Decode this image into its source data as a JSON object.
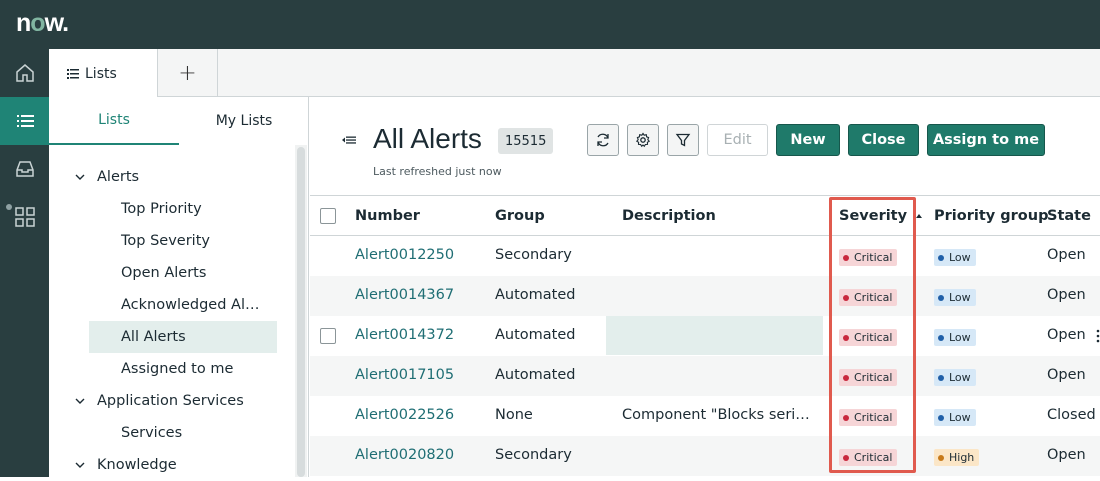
{
  "app": {
    "logo_text": "now",
    "brand_color": "#293e40",
    "accent_color": "#1f8476"
  },
  "rail": {
    "items": [
      "home-icon",
      "list-icon",
      "inbox-icon",
      "grid-icon"
    ],
    "active": "list-icon"
  },
  "tabs": {
    "lists_label": "Lists",
    "add_label": "+"
  },
  "sidebar": {
    "tabs": [
      "Lists",
      "My Lists"
    ],
    "active_tab": "Lists",
    "tree": [
      {
        "label": "Alerts",
        "type": "group"
      },
      {
        "label": "Top Priority",
        "type": "child"
      },
      {
        "label": "Top Severity",
        "type": "child"
      },
      {
        "label": "Open Alerts",
        "type": "child"
      },
      {
        "label": "Acknowledged Al…",
        "type": "child"
      },
      {
        "label": "All Alerts",
        "type": "child",
        "selected": true
      },
      {
        "label": "Assigned to me",
        "type": "child"
      },
      {
        "label": "Application Services",
        "type": "group"
      },
      {
        "label": "Services",
        "type": "child"
      },
      {
        "label": "Knowledge",
        "type": "group"
      }
    ]
  },
  "header": {
    "title": "All Alerts",
    "count": "15515",
    "last_refreshed": "Last refreshed just now",
    "icon_buttons": [
      "refresh-icon",
      "settings-icon",
      "filter-icon"
    ],
    "buttons": {
      "edit": "Edit",
      "new": "New",
      "close": "Close",
      "assign": "Assign to me"
    }
  },
  "table": {
    "columns": [
      "Number",
      "Group",
      "Description",
      "Severity",
      "Priority group",
      "State"
    ],
    "sort": {
      "column": "Severity",
      "direction": "ascending"
    },
    "rows": [
      {
        "number": "Alert0012250",
        "group": "Secondary",
        "description": "",
        "severity": "Critical",
        "priority": "Low",
        "state": "Open"
      },
      {
        "number": "Alert0014367",
        "group": "Automated",
        "description": "",
        "severity": "Critical",
        "priority": "Low",
        "state": "Open"
      },
      {
        "number": "Alert0014372",
        "group": "Automated",
        "description": "",
        "severity": "Critical",
        "priority": "Low",
        "state": "Open"
      },
      {
        "number": "Alert0017105",
        "group": "Automated",
        "description": "",
        "severity": "Critical",
        "priority": "Low",
        "state": "Open"
      },
      {
        "number": "Alert0022526",
        "group": "None",
        "description": "Component \"Blocks seri…",
        "severity": "Critical",
        "priority": "Low",
        "state": "Closed"
      },
      {
        "number": "Alert0020820",
        "group": "Secondary",
        "description": "",
        "severity": "Critical",
        "priority": "High",
        "state": "Open"
      }
    ]
  }
}
